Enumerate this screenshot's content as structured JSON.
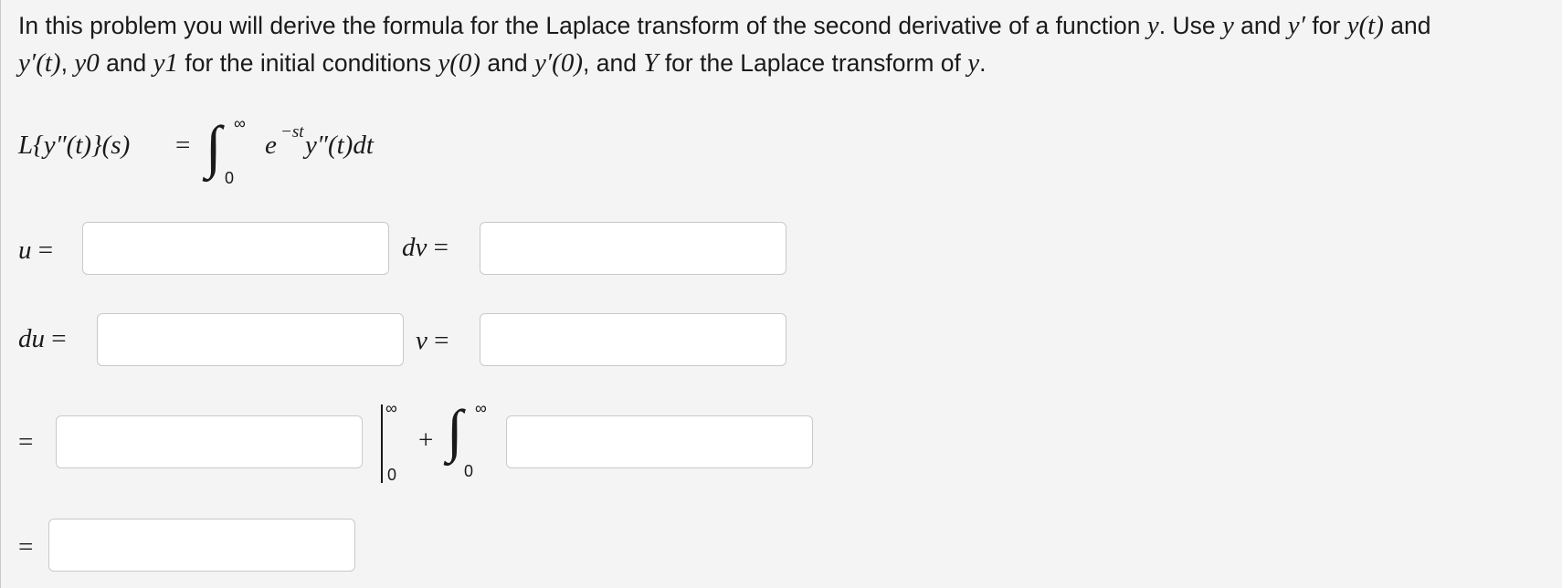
{
  "problem": {
    "t1": "In this problem you will derive the formula for the Laplace transform of the second derivative of a function ",
    "m1": "y",
    "t2": ". Use ",
    "m2": "y",
    "t3": " and ",
    "m3": "y′",
    "t4": " for ",
    "m4": "y(t)",
    "t5": " and",
    "m5": "y′(t)",
    "t6": ", ",
    "m6": "y0",
    "t7": " and ",
    "m7": "y1",
    "t8": " for the initial conditions ",
    "m8": "y(0)",
    "t9": " and ",
    "m9": "y′(0)",
    "t10": ", and ",
    "m10": "Y",
    "t11": " for the Laplace transform of ",
    "m11": "y",
    "t12": "."
  },
  "formula": {
    "lhs": "L{y″(t)}(s)",
    "eq": "=",
    "integral": "∫",
    "upper": "∞",
    "lower": "0",
    "base": "e",
    "exponent": "−st",
    "integrand": "y″(t)dt"
  },
  "labels": {
    "u": "u",
    "dv": "dv",
    "du": "du",
    "v": "v",
    "eq": "="
  },
  "parts": {
    "eval_upper": "∞",
    "eval_lower": "0",
    "plus": "+",
    "integral": "∫",
    "int_upper": "∞",
    "int_lower": "0"
  },
  "inputs": {
    "u": "",
    "dv": "",
    "du": "",
    "v": "",
    "uv_term": "",
    "vdu_integrand": "",
    "final_result": ""
  }
}
